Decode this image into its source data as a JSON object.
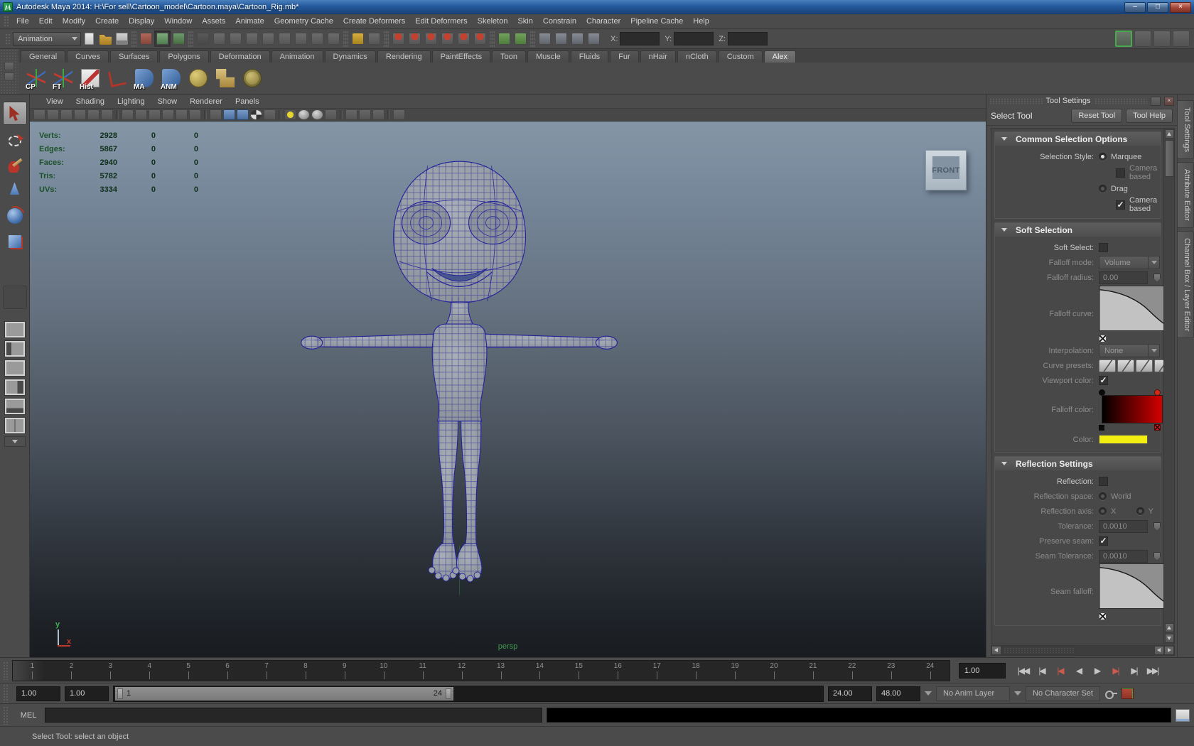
{
  "window": {
    "title": "Autodesk Maya 2014: H:\\For sell\\Cartoon_model\\Cartoon.maya\\Cartoon_Rig.mb*",
    "minimize_glyph": "–",
    "restore_glyph": "□",
    "close_glyph": "×"
  },
  "menu_bar": {
    "items": [
      "File",
      "Edit",
      "Modify",
      "Create",
      "Display",
      "Window",
      "Assets",
      "Animate",
      "Geometry Cache",
      "Create Deformers",
      "Edit Deformers",
      "Skeleton",
      "Skin",
      "Constrain",
      "Character",
      "Pipeline Cache",
      "Help"
    ]
  },
  "status_line": {
    "menu_set": "Animation",
    "groups": [
      [
        "new-scene",
        "open-scene",
        "save-scene"
      ],
      [
        "select-by-hierarchy",
        "select-by-object",
        "select-by-component"
      ],
      [
        "selection-mask-menu",
        "select-all-mask",
        "select-points",
        "select-curves",
        "select-surfaces",
        "select-deformations",
        "select-dynamics",
        "select-rendering",
        "select-miscellaneous"
      ],
      [
        "lock-selection",
        "highlight-selection-mode"
      ],
      [
        "snap-to-grids",
        "snap-to-curves",
        "snap-to-points",
        "snap-to-projected-center",
        "snap-to-view-planes",
        "make-live"
      ],
      [
        "inputs-to-selected",
        "outputs-from-selected"
      ],
      [
        "open-render-view",
        "render-current-frame",
        "ipr-render",
        "render-settings"
      ]
    ],
    "x_label": "X:",
    "y_label": "Y:",
    "z_label": "Z:",
    "sidebar_toggles": [
      {
        "name": "toggle-attribute-editor",
        "active": true
      },
      {
        "name": "toggle-tool-settings",
        "active": false
      },
      {
        "name": "toggle-channel-box",
        "active": false
      },
      {
        "name": "toggle-modeling-toolkit",
        "active": false
      }
    ]
  },
  "shelf": {
    "tabs": [
      "General",
      "Curves",
      "Surfaces",
      "Polygons",
      "Deformation",
      "Animation",
      "Dynamics",
      "Rendering",
      "PaintEffects",
      "Toon",
      "Muscle",
      "Fluids",
      "Fur",
      "nHair",
      "nCloth",
      "Custom",
      "Alex"
    ],
    "active_tab": "Alex",
    "items": [
      {
        "label": "CP",
        "kind": "axis"
      },
      {
        "label": "FT",
        "kind": "axis"
      },
      {
        "label": "Hist",
        "kind": "pencil"
      },
      {
        "label": "",
        "kind": "tsquare"
      },
      {
        "label": "MA",
        "kind": "flag"
      },
      {
        "label": "ANM",
        "kind": "flag"
      },
      {
        "label": "",
        "kind": "gold-cluster"
      },
      {
        "label": "",
        "kind": "boxes"
      },
      {
        "label": "",
        "kind": "wire-sphere"
      }
    ]
  },
  "toolbox": {
    "tools": [
      {
        "name": "select-tool",
        "active": true
      },
      {
        "name": "lasso-tool",
        "active": false
      },
      {
        "name": "paint-select-tool",
        "active": false
      },
      {
        "name": "move-tool",
        "active": false
      },
      {
        "name": "rotate-tool",
        "active": false
      },
      {
        "name": "scale-tool",
        "active": false
      }
    ],
    "layouts": [
      "layout-outliner-persp",
      "layout-persp-side",
      "layout-single-persp",
      "layout-persp-uv",
      "layout-hypershade",
      "layout-graph-editor"
    ]
  },
  "viewport": {
    "menu": [
      "View",
      "Shading",
      "Lighting",
      "Show",
      "Renderer",
      "Panels"
    ],
    "toolbar": [
      "select-camera",
      "camera-attributes",
      "bookmarks",
      "image-plane",
      "2d-pan-zoom",
      "grease-pencil",
      "|",
      "film-gate",
      "resolution-gate",
      "gate-mask",
      "field-chart",
      "safe-action",
      "safe-title",
      "|",
      "wireframe-mode",
      "smooth-shade-mode",
      "textured-mode",
      "use-default-material",
      "wireframe-on-shaded",
      "|",
      "lighting-default",
      "lighting-all",
      "lighting-selected",
      "shadows",
      "|",
      "isolate-select",
      "xray-mode",
      "xray-joints-mode",
      "|",
      "plugin-shelf"
    ],
    "hud": {
      "rows": [
        {
          "label": "Verts:",
          "total": "2928",
          "selected": "0",
          "highlighted": "0"
        },
        {
          "label": "Edges:",
          "total": "5867",
          "selected": "0",
          "highlighted": "0"
        },
        {
          "label": "Faces:",
          "total": "2940",
          "selected": "0",
          "highlighted": "0"
        },
        {
          "label": "Tris:",
          "total": "5782",
          "selected": "0",
          "highlighted": "0"
        },
        {
          "label": "UVs:",
          "total": "3334",
          "selected": "0",
          "highlighted": "0"
        }
      ]
    },
    "camera_label": "persp",
    "image_plane_label": "FRONT",
    "axis": {
      "y_label": "y",
      "x_label": "x"
    }
  },
  "tool_settings": {
    "panel_title": "Tool Settings",
    "tool_name": "Select Tool",
    "reset_button": "Reset Tool",
    "help_button": "Tool Help",
    "side_tabs": [
      "Tool Settings",
      "Attribute Editor",
      "Channel Box / Layer Editor"
    ],
    "common_selection": {
      "title": "Common Selection Options",
      "selection_style_label": "Selection Style:",
      "marquee_label": "Marquee",
      "camera_based_1_label": "Camera based",
      "camera_based_1_check": "",
      "drag_label": "Drag",
      "camera_based_2_label": "Camera based",
      "camera_based_2_check": "✓"
    },
    "soft_selection": {
      "title": "Soft Selection",
      "soft_select_label": "Soft Select:",
      "soft_select_check": "",
      "falloff_mode_label": "Falloff mode:",
      "falloff_mode_value": "Volume",
      "falloff_radius_label": "Falloff radius:",
      "falloff_radius_value": "0.00",
      "falloff_curve_label": "Falloff curve:",
      "interpolation_label": "Interpolation:",
      "interpolation_value": "None",
      "curve_presets_label": "Curve presets:",
      "viewport_color_label": "Viewport color:",
      "viewport_color_check": "✓",
      "falloff_color_label": "Falloff color:",
      "color_label": "Color:",
      "color_value": "#f2ee11"
    },
    "reflection": {
      "title": "Reflection Settings",
      "reflection_label": "Reflection:",
      "reflection_check": "",
      "space_label": "Reflection space:",
      "space_world_label": "World",
      "axis_label": "Reflection axis:",
      "axis_x_label": "X",
      "axis_y_label": "Y",
      "tolerance_label": "Tolerance:",
      "tolerance_value": "0.0010",
      "preserve_seam_label": "Preserve seam:",
      "preserve_seam_check": "✓",
      "seam_tolerance_label": "Seam Tolerance:",
      "seam_tolerance_value": "0.0010",
      "seam_falloff_label": "Seam falloff:"
    }
  },
  "time_slider": {
    "frames": [
      "1",
      "2",
      "3",
      "4",
      "5",
      "6",
      "7",
      "8",
      "9",
      "10",
      "11",
      "12",
      "13",
      "14",
      "15",
      "16",
      "17",
      "18",
      "19",
      "20",
      "21",
      "22",
      "23",
      "24"
    ],
    "current_frame": "1",
    "current_time": "1.00",
    "playback_buttons": [
      {
        "name": "go-to-start",
        "glyph": "|◀◀",
        "red": false
      },
      {
        "name": "step-back-frame",
        "glyph": "|◀",
        "red": false
      },
      {
        "name": "step-back-key",
        "glyph": "|◀",
        "red": true
      },
      {
        "name": "play-backwards",
        "glyph": "◀",
        "red": false
      },
      {
        "name": "play-forwards",
        "glyph": "▶",
        "red": false
      },
      {
        "name": "step-forward-key",
        "glyph": "▶|",
        "red": true
      },
      {
        "name": "step-forward-frame",
        "glyph": "▶|",
        "red": false
      },
      {
        "name": "go-to-end",
        "glyph": "▶▶|",
        "red": false
      }
    ]
  },
  "range_slider": {
    "animation_start": "1.00",
    "playback_start": "1.00",
    "range_start": "1",
    "range_end": "24",
    "playback_end": "24.00",
    "animation_end": "48.00",
    "anim_layer": "No Anim Layer",
    "character_set": "No Character Set"
  },
  "command_line": {
    "label": "MEL"
  },
  "help_line": {
    "text": "Select Tool: select an object"
  },
  "colors": {
    "hud_label": "#1c5129",
    "hud_value": "#0e2f1a",
    "falloff_swatch": "#f2ee11",
    "falloff_gradient_start": "#000000",
    "falloff_gradient_end": "#d40000",
    "viewport_top": "#8496a6",
    "viewport_bottom": "#191c20",
    "title_bar": "#245a9c"
  }
}
